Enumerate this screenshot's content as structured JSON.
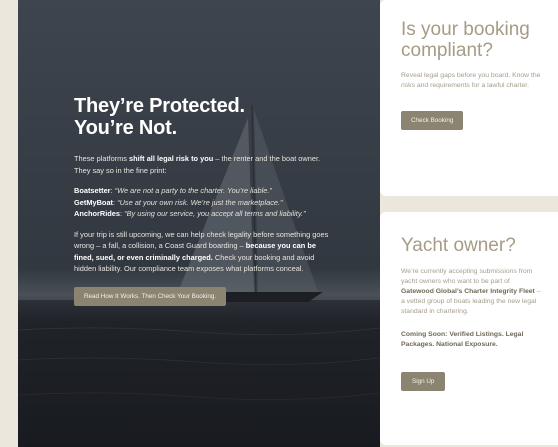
{
  "hero": {
    "title_line1": "They’re Protected.",
    "title_line2": "You’re Not.",
    "intro": {
      "pre": "These platforms ",
      "bold": "shift all legal risk to you",
      "post": " – the renter and the boat owner. They say so in the fine print:"
    },
    "quotes": [
      {
        "name": "Boatsetter",
        "text": "“We are not a party to the charter. You’re liable.”"
      },
      {
        "name": "GetMyBoat",
        "text": "“Use at your own risk. We’re just the marketplace.”"
      },
      {
        "name": "AnchorRides",
        "text": "“By using our service, you accept all terms and liability.”"
      }
    ],
    "body": {
      "pre": "If your trip is still upcoming, we can help check legality before something goes wrong – a fall, a collision, a Coast Guard boarding – ",
      "bold": "because you can be fined, sued, or even criminally charged.",
      "post": " Check your booking and avoid hidden liability. Our compliance team exposes what platforms conceal."
    },
    "button_label": "Read How It Works. Then Check Your Booking."
  },
  "compliance_card": {
    "title": "Is your booking compliant?",
    "text": "Reveal legal gaps before you board. Know the risks and requirements for a lawful charter.",
    "button_label": "Check Booking"
  },
  "owner_card": {
    "title": "Yacht owner?",
    "text_pre": "We’re currently accepting submissions from yacht owners who want to be part of ",
    "text_bold": "Gatewood Global’s Charter Integrity Fleet",
    "text_post": " – a vetted group of boats leading the new legal standard in chartering.",
    "coming_soon": "Coming Soon: Verified Listings. Legal Packages. National Exposure.",
    "button_label": "Sign Up"
  },
  "colors": {
    "accent": "#8a8470",
    "card_title": "#a69c86",
    "hero_bg": "#2f353d"
  }
}
